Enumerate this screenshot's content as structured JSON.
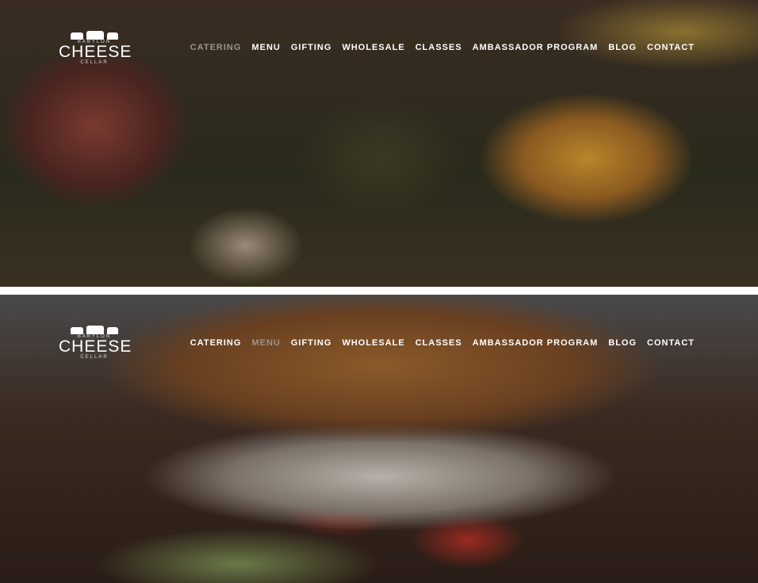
{
  "logo": {
    "top": "BABYLON",
    "main": "CHEESE",
    "bottom": "CELLAR"
  },
  "nav": [
    "CATERING",
    "MENU",
    "GIFTING",
    "WHOLESALE",
    "CLASSES",
    "AMBASSADOR PROGRAM",
    "BLOG",
    "CONTACT"
  ],
  "sections": [
    {
      "active": "CATERING"
    },
    {
      "active": "MENU"
    }
  ]
}
